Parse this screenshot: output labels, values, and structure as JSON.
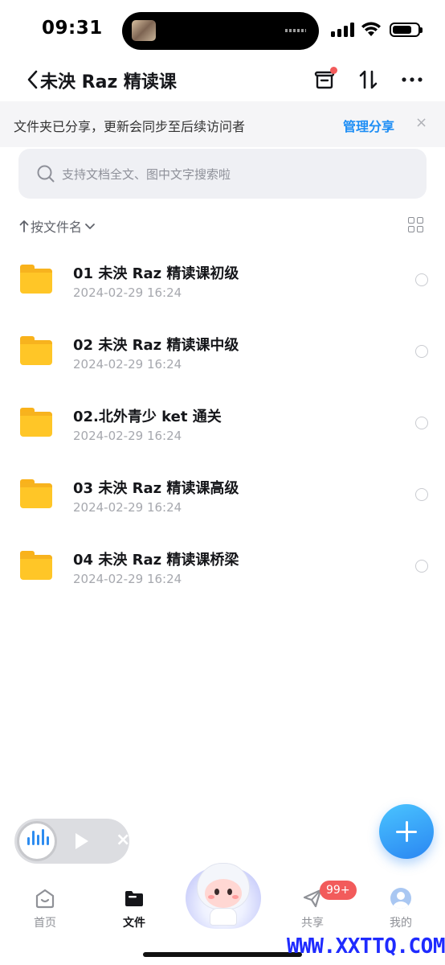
{
  "status_bar": {
    "time": "09:31",
    "battery_level": 0.75
  },
  "nav": {
    "title": "未泱 Raz 精读课",
    "icons": [
      "back-chevron-icon",
      "inbox-icon",
      "sort-arrows-icon",
      "more-icon"
    ]
  },
  "share_banner": {
    "text": "文件夹已分享，更新会同步至后续访问者",
    "manage_label": "管理分享",
    "close_glyph": "×"
  },
  "search": {
    "placeholder": "支持文档全文、图中文字搜索啦"
  },
  "sort": {
    "label": "按文件名"
  },
  "files": [
    {
      "name": "01 未泱 Raz 精读课初级",
      "date": "2024-02-29 16:24"
    },
    {
      "name": "02 未泱 Raz 精读课中级",
      "date": "2024-02-29 16:24"
    },
    {
      "name": "02.北外青少 ket 通关",
      "date": "2024-02-29 16:24"
    },
    {
      "name": "03 未泱 Raz 精读课高级",
      "date": "2024-02-29 16:24"
    },
    {
      "name": "04 未泱 Raz 精读课桥梁",
      "date": "2024-02-29 16:24"
    }
  ],
  "tabs": [
    {
      "label": "首页",
      "icon": "home-icon"
    },
    {
      "label": "文件",
      "icon": "folder-icon"
    },
    {
      "label": "共享",
      "icon": "send-icon"
    },
    {
      "label": "我的",
      "icon": "avatar-icon"
    }
  ],
  "share_badge": "99+",
  "watermark": "WWW.XXTTQ.COM",
  "colors": {
    "accent": "#1e8ef5",
    "folder": "#ffc627",
    "badge": "#f25b5b",
    "watermark": "#1f2bff"
  }
}
